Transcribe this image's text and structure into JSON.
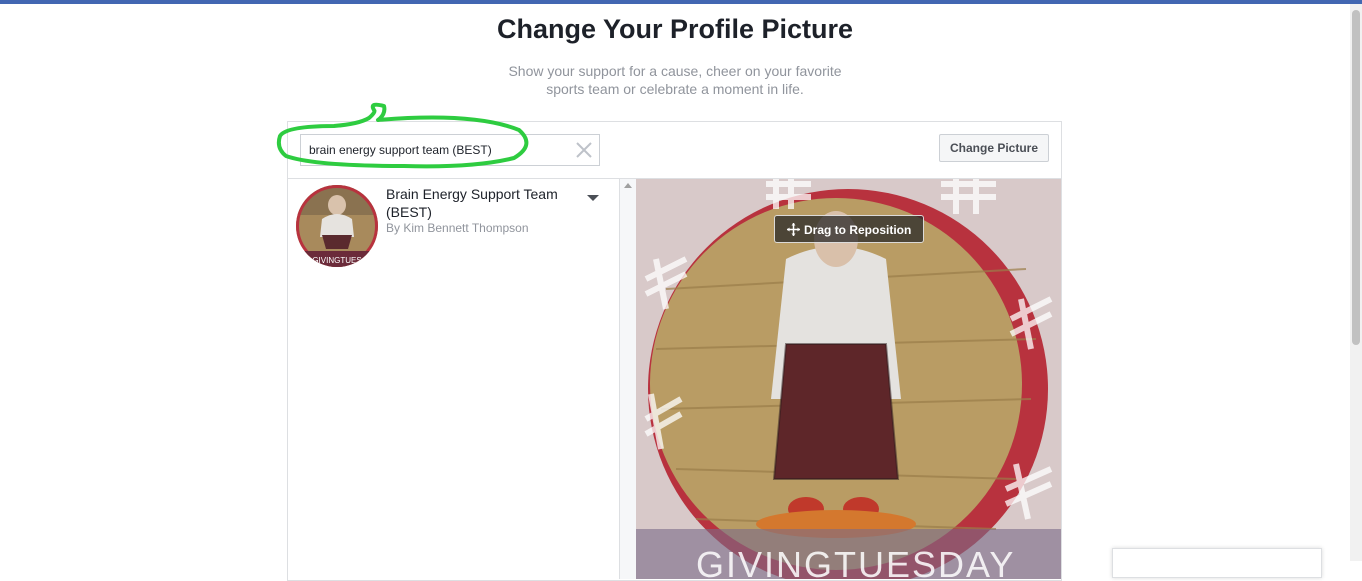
{
  "page": {
    "title": "Change Your Profile Picture",
    "subtitle": "Show your support for a cause, cheer on your favorite sports team or celebrate a moment in life."
  },
  "search": {
    "value": "brain energy support team (BEST)",
    "clear_icon": "close-icon"
  },
  "toolbar": {
    "change_label": "Change Picture"
  },
  "results": [
    {
      "title": "Brain Energy Support Team (BEST)",
      "author": "By Kim Bennett Thompson"
    }
  ],
  "preview": {
    "drag_label": "Drag to Reposition",
    "brand_text": "GIVINGTUESDAY"
  },
  "colors": {
    "accent": "#4267b2",
    "highlight": "#2ecc40",
    "frame_red": "#b8323e"
  }
}
